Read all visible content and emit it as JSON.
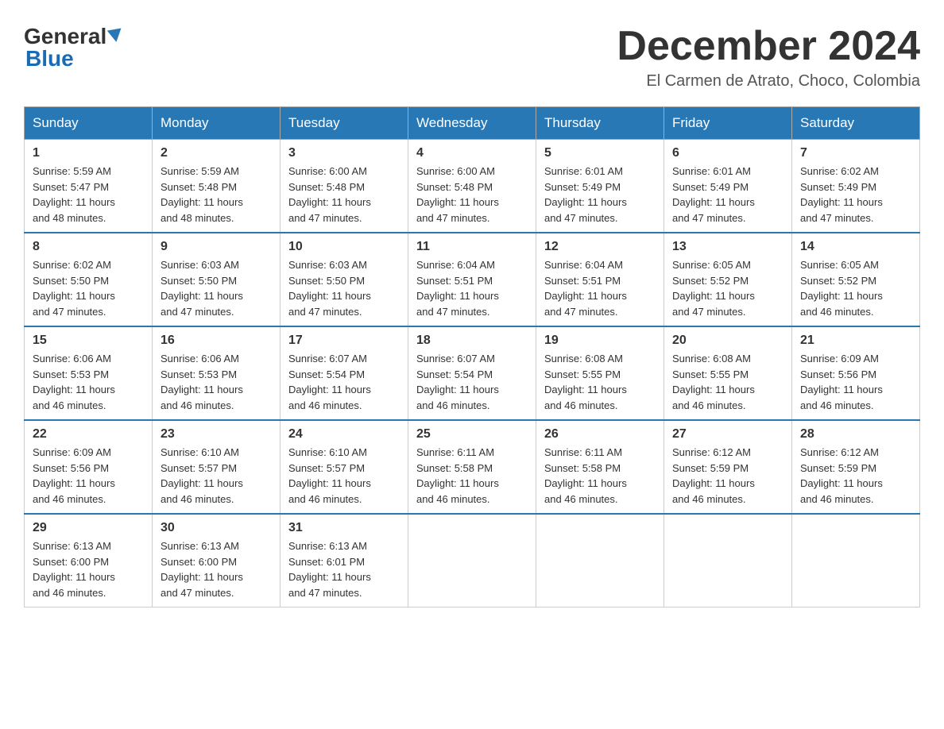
{
  "header": {
    "logo_general": "General",
    "logo_blue": "Blue",
    "month_title": "December 2024",
    "location": "El Carmen de Atrato, Choco, Colombia"
  },
  "days_of_week": [
    "Sunday",
    "Monday",
    "Tuesday",
    "Wednesday",
    "Thursday",
    "Friday",
    "Saturday"
  ],
  "weeks": [
    [
      {
        "day": "1",
        "sunrise": "5:59 AM",
        "sunset": "5:47 PM",
        "daylight": "11 hours and 48 minutes."
      },
      {
        "day": "2",
        "sunrise": "5:59 AM",
        "sunset": "5:48 PM",
        "daylight": "11 hours and 48 minutes."
      },
      {
        "day": "3",
        "sunrise": "6:00 AM",
        "sunset": "5:48 PM",
        "daylight": "11 hours and 47 minutes."
      },
      {
        "day": "4",
        "sunrise": "6:00 AM",
        "sunset": "5:48 PM",
        "daylight": "11 hours and 47 minutes."
      },
      {
        "day": "5",
        "sunrise": "6:01 AM",
        "sunset": "5:49 PM",
        "daylight": "11 hours and 47 minutes."
      },
      {
        "day": "6",
        "sunrise": "6:01 AM",
        "sunset": "5:49 PM",
        "daylight": "11 hours and 47 minutes."
      },
      {
        "day": "7",
        "sunrise": "6:02 AM",
        "sunset": "5:49 PM",
        "daylight": "11 hours and 47 minutes."
      }
    ],
    [
      {
        "day": "8",
        "sunrise": "6:02 AM",
        "sunset": "5:50 PM",
        "daylight": "11 hours and 47 minutes."
      },
      {
        "day": "9",
        "sunrise": "6:03 AM",
        "sunset": "5:50 PM",
        "daylight": "11 hours and 47 minutes."
      },
      {
        "day": "10",
        "sunrise": "6:03 AM",
        "sunset": "5:50 PM",
        "daylight": "11 hours and 47 minutes."
      },
      {
        "day": "11",
        "sunrise": "6:04 AM",
        "sunset": "5:51 PM",
        "daylight": "11 hours and 47 minutes."
      },
      {
        "day": "12",
        "sunrise": "6:04 AM",
        "sunset": "5:51 PM",
        "daylight": "11 hours and 47 minutes."
      },
      {
        "day": "13",
        "sunrise": "6:05 AM",
        "sunset": "5:52 PM",
        "daylight": "11 hours and 47 minutes."
      },
      {
        "day": "14",
        "sunrise": "6:05 AM",
        "sunset": "5:52 PM",
        "daylight": "11 hours and 46 minutes."
      }
    ],
    [
      {
        "day": "15",
        "sunrise": "6:06 AM",
        "sunset": "5:53 PM",
        "daylight": "11 hours and 46 minutes."
      },
      {
        "day": "16",
        "sunrise": "6:06 AM",
        "sunset": "5:53 PM",
        "daylight": "11 hours and 46 minutes."
      },
      {
        "day": "17",
        "sunrise": "6:07 AM",
        "sunset": "5:54 PM",
        "daylight": "11 hours and 46 minutes."
      },
      {
        "day": "18",
        "sunrise": "6:07 AM",
        "sunset": "5:54 PM",
        "daylight": "11 hours and 46 minutes."
      },
      {
        "day": "19",
        "sunrise": "6:08 AM",
        "sunset": "5:55 PM",
        "daylight": "11 hours and 46 minutes."
      },
      {
        "day": "20",
        "sunrise": "6:08 AM",
        "sunset": "5:55 PM",
        "daylight": "11 hours and 46 minutes."
      },
      {
        "day": "21",
        "sunrise": "6:09 AM",
        "sunset": "5:56 PM",
        "daylight": "11 hours and 46 minutes."
      }
    ],
    [
      {
        "day": "22",
        "sunrise": "6:09 AM",
        "sunset": "5:56 PM",
        "daylight": "11 hours and 46 minutes."
      },
      {
        "day": "23",
        "sunrise": "6:10 AM",
        "sunset": "5:57 PM",
        "daylight": "11 hours and 46 minutes."
      },
      {
        "day": "24",
        "sunrise": "6:10 AM",
        "sunset": "5:57 PM",
        "daylight": "11 hours and 46 minutes."
      },
      {
        "day": "25",
        "sunrise": "6:11 AM",
        "sunset": "5:58 PM",
        "daylight": "11 hours and 46 minutes."
      },
      {
        "day": "26",
        "sunrise": "6:11 AM",
        "sunset": "5:58 PM",
        "daylight": "11 hours and 46 minutes."
      },
      {
        "day": "27",
        "sunrise": "6:12 AM",
        "sunset": "5:59 PM",
        "daylight": "11 hours and 46 minutes."
      },
      {
        "day": "28",
        "sunrise": "6:12 AM",
        "sunset": "5:59 PM",
        "daylight": "11 hours and 46 minutes."
      }
    ],
    [
      {
        "day": "29",
        "sunrise": "6:13 AM",
        "sunset": "6:00 PM",
        "daylight": "11 hours and 46 minutes."
      },
      {
        "day": "30",
        "sunrise": "6:13 AM",
        "sunset": "6:00 PM",
        "daylight": "11 hours and 47 minutes."
      },
      {
        "day": "31",
        "sunrise": "6:13 AM",
        "sunset": "6:01 PM",
        "daylight": "11 hours and 47 minutes."
      },
      null,
      null,
      null,
      null
    ]
  ],
  "labels": {
    "sunrise_prefix": "Sunrise: ",
    "sunset_prefix": "Sunset: ",
    "daylight_prefix": "Daylight: "
  }
}
